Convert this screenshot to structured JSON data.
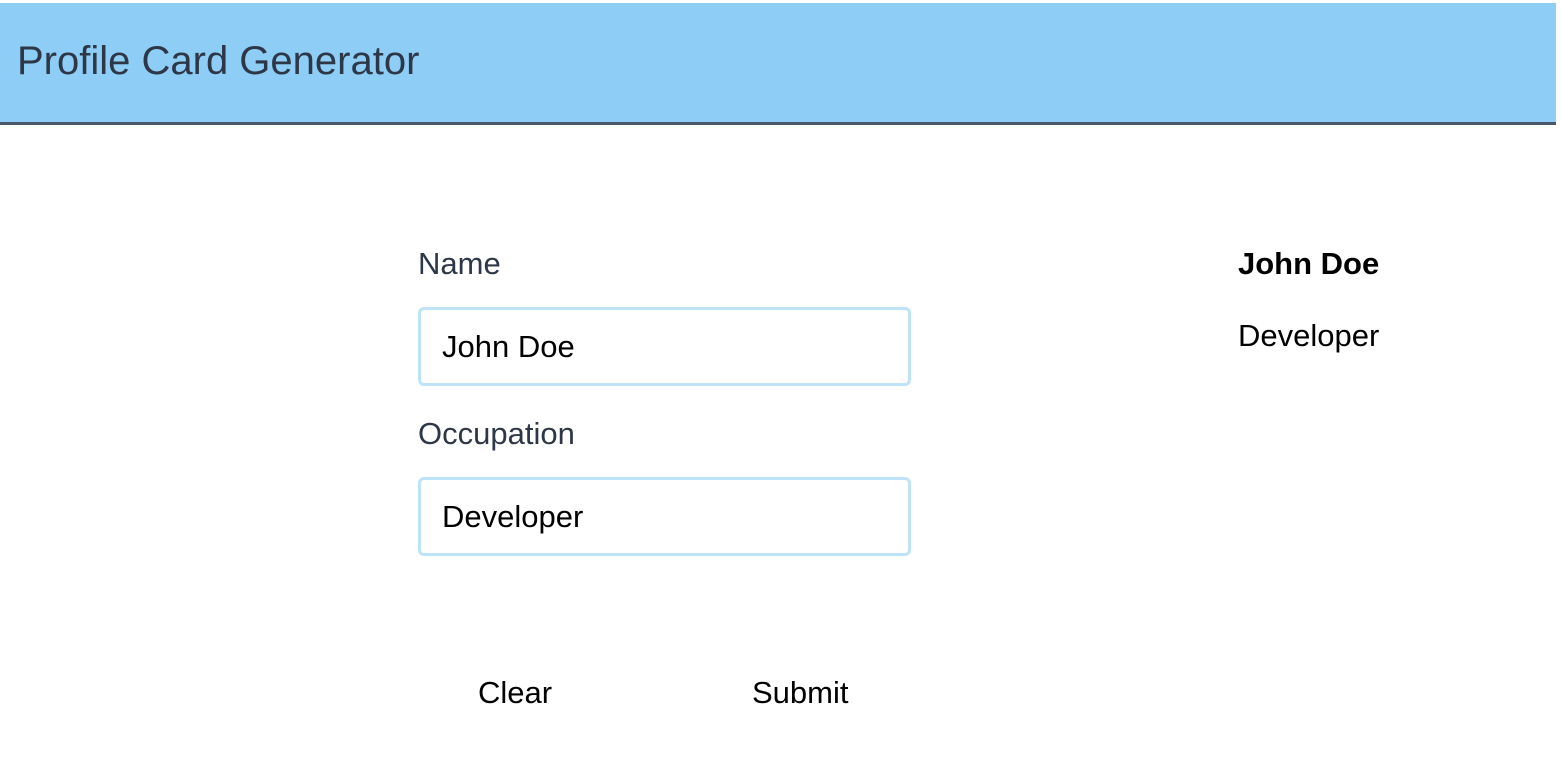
{
  "header": {
    "title": "Profile Card Generator",
    "background_color": "#8ecdf5"
  },
  "form": {
    "name_label": "Name",
    "name_value": "John Doe",
    "occupation_label": "Occupation",
    "occupation_value": "Developer",
    "input_border_color": "#bee3f8"
  },
  "actions": {
    "clear_label": "Clear",
    "submit_label": "Submit"
  },
  "profile_card": {
    "name": "John Doe",
    "occupation": "Developer"
  }
}
